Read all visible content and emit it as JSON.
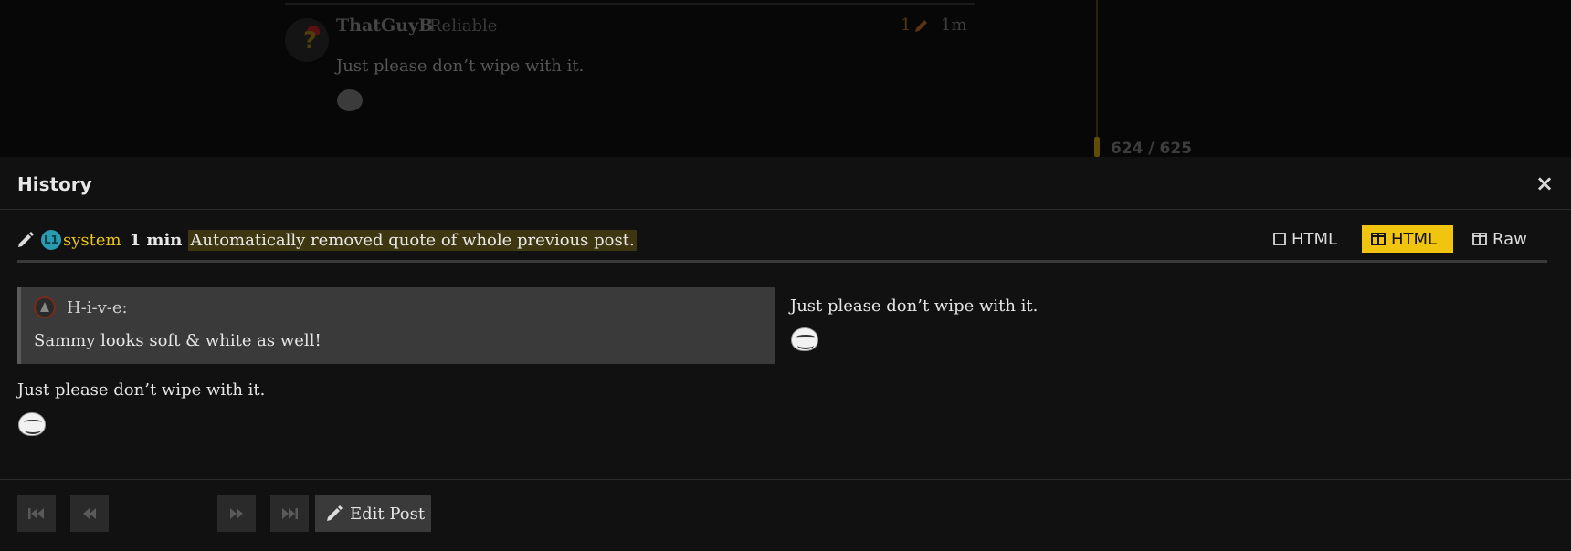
{
  "background_post": {
    "username": "ThatGuyB",
    "user_title": "Reliable",
    "edit_count": "1",
    "age": "1m",
    "text": "Just please don’t wipe with it.",
    "emoji": "trollface-icon",
    "progress": "624 / 625"
  },
  "modal": {
    "title": "History",
    "close_label": "×"
  },
  "revision": {
    "user": "system",
    "avatar_text": "L1",
    "time": "1 min",
    "reason": "Automatically removed quote of whole previous post."
  },
  "view_modes": {
    "inline": "HTML",
    "side_by_side": "HTML",
    "raw": "Raw",
    "active": "side_by_side"
  },
  "diff": {
    "left": {
      "quote_author": "H-i-v-e:",
      "quote_text": "Sammy looks soft & white as well!",
      "text": "Just please don’t wipe with it."
    },
    "right": {
      "text": "Just please don’t wipe with it."
    }
  },
  "footer": {
    "edit_label": "Edit Post"
  },
  "colors": {
    "accent": "#f0c40f",
    "highlight": "#3e3610",
    "modal_bg": "#111111"
  }
}
